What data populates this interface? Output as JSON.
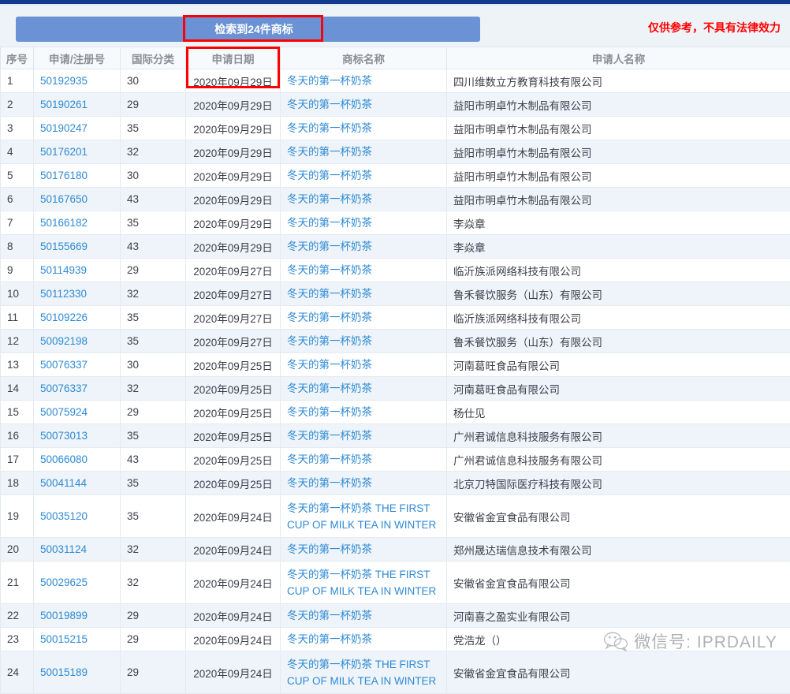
{
  "banner": {
    "result_text": "检索到24件商标",
    "disclaimer": "仅供参考，不具有法律效力",
    "banner_color": "#6a92d4",
    "highlight_color": "#ff0000",
    "link_color": "#2f8ad4"
  },
  "table": {
    "columns": [
      "序号",
      "申请/注册号",
      "国际分类",
      "申请日期",
      "商标名称",
      "申请人名称"
    ],
    "rows": [
      {
        "seq": "1",
        "appno": "50192935",
        "cls": "30",
        "date": "2020年09月29日",
        "name": "冬天的第一杯奶茶",
        "applicant": "四川维数立方教育科技有限公司"
      },
      {
        "seq": "2",
        "appno": "50190261",
        "cls": "29",
        "date": "2020年09月29日",
        "name": "冬天的第一杯奶茶",
        "applicant": "益阳市明卓竹木制品有限公司"
      },
      {
        "seq": "3",
        "appno": "50190247",
        "cls": "35",
        "date": "2020年09月29日",
        "name": "冬天的第一杯奶茶",
        "applicant": "益阳市明卓竹木制品有限公司"
      },
      {
        "seq": "4",
        "appno": "50176201",
        "cls": "32",
        "date": "2020年09月29日",
        "name": "冬天的第一杯奶茶",
        "applicant": "益阳市明卓竹木制品有限公司"
      },
      {
        "seq": "5",
        "appno": "50176180",
        "cls": "30",
        "date": "2020年09月29日",
        "name": "冬天的第一杯奶茶",
        "applicant": "益阳市明卓竹木制品有限公司"
      },
      {
        "seq": "6",
        "appno": "50167650",
        "cls": "43",
        "date": "2020年09月29日",
        "name": "冬天的第一杯奶茶",
        "applicant": "益阳市明卓竹木制品有限公司"
      },
      {
        "seq": "7",
        "appno": "50166182",
        "cls": "35",
        "date": "2020年09月29日",
        "name": "冬天的第一杯奶茶",
        "applicant": "李焱章"
      },
      {
        "seq": "8",
        "appno": "50155669",
        "cls": "43",
        "date": "2020年09月29日",
        "name": "冬天的第一杯奶茶",
        "applicant": "李焱章"
      },
      {
        "seq": "9",
        "appno": "50114939",
        "cls": "29",
        "date": "2020年09月27日",
        "name": "冬天的第一杯奶茶",
        "applicant": "临沂族派网络科技有限公司"
      },
      {
        "seq": "10",
        "appno": "50112330",
        "cls": "32",
        "date": "2020年09月27日",
        "name": "冬天的第一杯奶茶",
        "applicant": "鲁禾餐饮服务（山东）有限公司"
      },
      {
        "seq": "11",
        "appno": "50109226",
        "cls": "35",
        "date": "2020年09月27日",
        "name": "冬天的第一杯奶茶",
        "applicant": "临沂族派网络科技有限公司"
      },
      {
        "seq": "12",
        "appno": "50092198",
        "cls": "35",
        "date": "2020年09月27日",
        "name": "冬天的第一杯奶茶",
        "applicant": "鲁禾餐饮服务（山东）有限公司"
      },
      {
        "seq": "13",
        "appno": "50076337",
        "cls": "30",
        "date": "2020年09月25日",
        "name": "冬天的第一杯奶茶",
        "applicant": "河南葛旺食品有限公司"
      },
      {
        "seq": "14",
        "appno": "50076337",
        "cls": "32",
        "date": "2020年09月25日",
        "name": "冬天的第一杯奶茶",
        "applicant": "河南葛旺食品有限公司"
      },
      {
        "seq": "15",
        "appno": "50075924",
        "cls": "29",
        "date": "2020年09月25日",
        "name": "冬天的第一杯奶茶",
        "applicant": "杨仕见"
      },
      {
        "seq": "16",
        "appno": "50073013",
        "cls": "35",
        "date": "2020年09月25日",
        "name": "冬天的第一杯奶茶",
        "applicant": "广州君诚信息科技服务有限公司"
      },
      {
        "seq": "17",
        "appno": "50066080",
        "cls": "43",
        "date": "2020年09月25日",
        "name": "冬天的第一杯奶茶",
        "applicant": "广州君诚信息科技服务有限公司"
      },
      {
        "seq": "18",
        "appno": "50041144",
        "cls": "35",
        "date": "2020年09月25日",
        "name": "冬天的第一杯奶茶",
        "applicant": "北京刀特国际医疗科技有限公司"
      },
      {
        "seq": "19",
        "appno": "50035120",
        "cls": "35",
        "date": "2020年09月24日",
        "name": "冬天的第一杯奶茶 THE FIRST CUP OF MILK TEA IN WINTER",
        "applicant": "安徽省金宜食品有限公司",
        "tall": true
      },
      {
        "seq": "20",
        "appno": "50031124",
        "cls": "32",
        "date": "2020年09月24日",
        "name": "冬天的第一杯奶茶",
        "applicant": "郑州晟达瑞信息技术有限公司"
      },
      {
        "seq": "21",
        "appno": "50029625",
        "cls": "32",
        "date": "2020年09月24日",
        "name": "冬天的第一杯奶茶 THE FIRST CUP OF MILK TEA IN WINTER",
        "applicant": "安徽省金宜食品有限公司",
        "tall": true
      },
      {
        "seq": "22",
        "appno": "50019899",
        "cls": "29",
        "date": "2020年09月24日",
        "name": "冬天的第一杯奶茶",
        "applicant": "河南喜之盈实业有限公司"
      },
      {
        "seq": "23",
        "appno": "50015215",
        "cls": "29",
        "date": "2020年09月24日",
        "name": "冬天的第一杯奶茶",
        "applicant": "党浩龙（）"
      },
      {
        "seq": "24",
        "appno": "50015189",
        "cls": "29",
        "date": "2020年09月24日",
        "name": "冬天的第一杯奶茶 THE FIRST CUP OF MILK TEA IN WINTER",
        "applicant": "安徽省金宜食品有限公司",
        "tall": true
      }
    ]
  },
  "watermark": {
    "text": "微信号: IPRDAILY",
    "icon": "wechat-icon"
  }
}
